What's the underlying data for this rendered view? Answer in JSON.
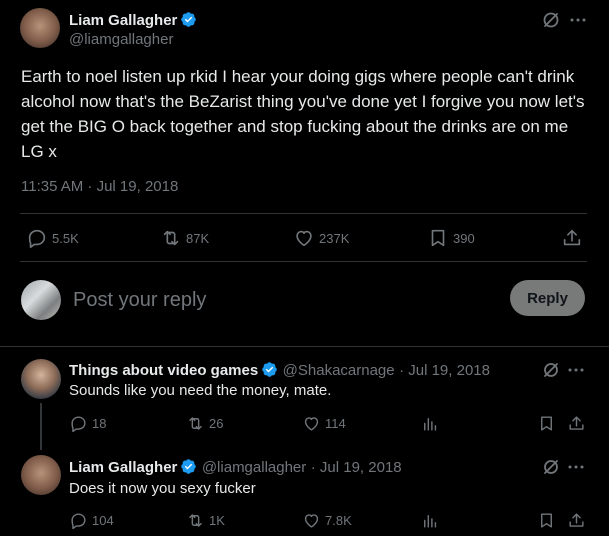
{
  "main_tweet": {
    "author_name": "Liam Gallagher",
    "author_handle": "@liamgallagher",
    "text": "Earth to noel listen up rkid I hear your doing gigs where people can't drink alcohol now that's the BeZarist thing you've done yet I forgive you now let's get the BIG O back together and stop fucking about the drinks are on me LG x",
    "timestamp": "11:35 AM · Jul 19, 2018",
    "replies": "5.5K",
    "reposts": "87K",
    "likes": "237K",
    "bookmarks": "390"
  },
  "composer": {
    "placeholder": "Post your reply",
    "button_label": "Reply"
  },
  "replies": [
    {
      "author_name": "Things about video games",
      "author_handle": "@Shakacarnage",
      "date": "· Jul 19, 2018",
      "text": "Sounds like you need the money, mate.",
      "replies": "18",
      "reposts": "26",
      "likes": "114"
    },
    {
      "author_name": "Liam Gallagher",
      "author_handle": "@liamgallagher",
      "date": "· Jul 19, 2018",
      "text": "Does it now you sexy fucker",
      "replies": "104",
      "reposts": "1K",
      "likes": "7.8K"
    }
  ],
  "colors": {
    "background": "#000000",
    "text": "#e7e9ea",
    "muted": "#71767b",
    "verified": "#1d9bf0",
    "divider": "#2f3336"
  },
  "icons": [
    "grok-icon",
    "more-icon",
    "verified-icon",
    "reply-icon",
    "repost-icon",
    "like-icon",
    "views-icon",
    "bookmark-icon",
    "share-icon"
  ]
}
